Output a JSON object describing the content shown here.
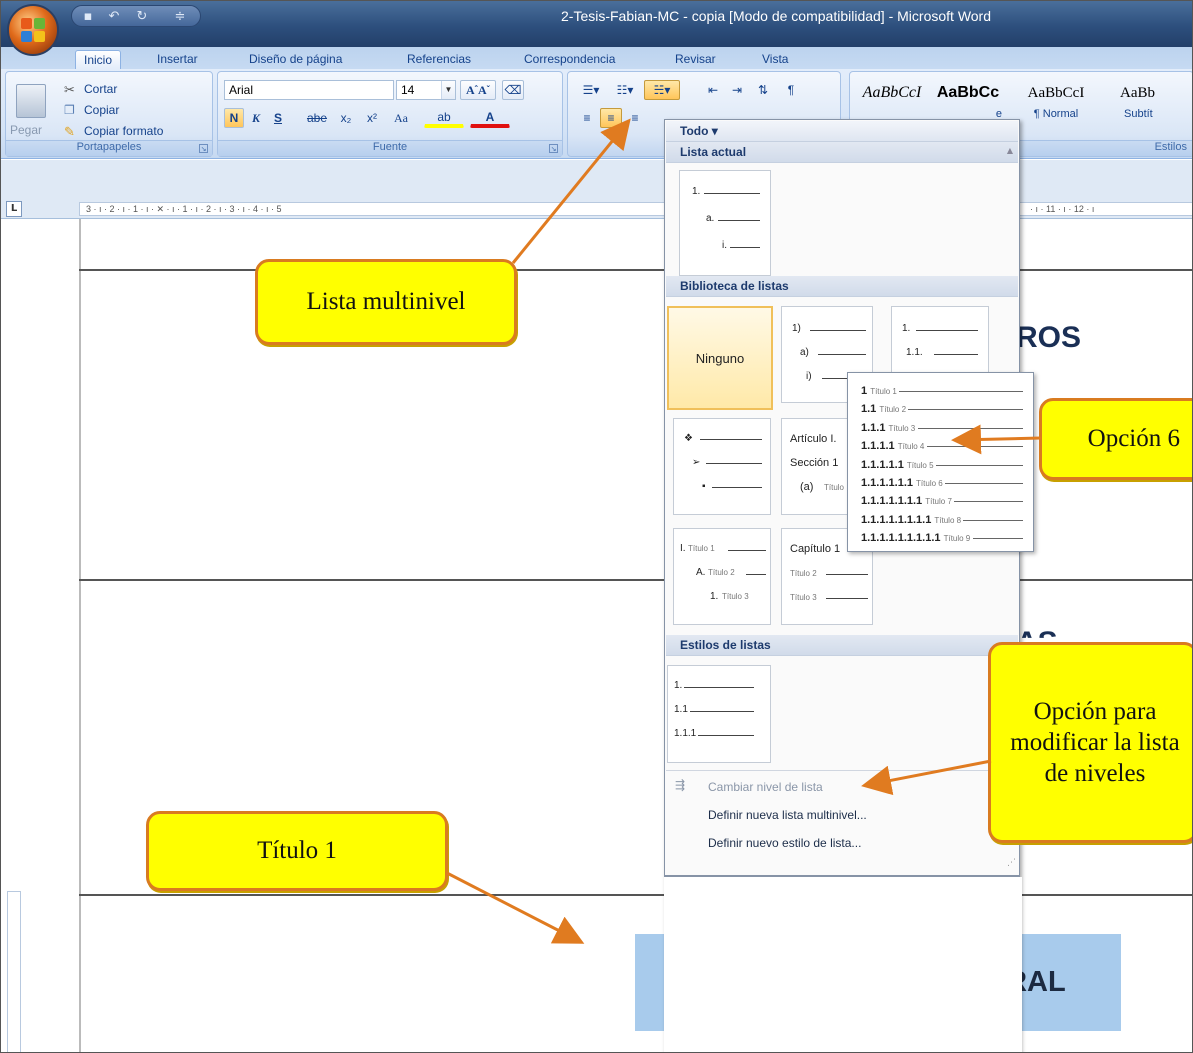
{
  "window": {
    "title": "2-Tesis-Fabian-MC - copia [Modo de compatibilidad] - Microsoft Word"
  },
  "tabs": [
    {
      "label": "Inicio"
    },
    {
      "label": "Insertar"
    },
    {
      "label": "Diseño de página"
    },
    {
      "label": "Referencias"
    },
    {
      "label": "Correspondencia"
    },
    {
      "label": "Revisar"
    },
    {
      "label": "Vista"
    }
  ],
  "ribbon": {
    "clipboard": {
      "paste": "Pegar",
      "cut": "Cortar",
      "copy": "Copiar",
      "format_painter": "Copiar formato",
      "group": "Portapapeles"
    },
    "font": {
      "name": "Arial",
      "size": "14",
      "group": "Fuente",
      "bold": "N",
      "italic": "K",
      "underline": "S",
      "strike": "abe",
      "sub": "x₂",
      "sup": "x²",
      "case": "Aa",
      "highlight": "ab",
      "color": "A"
    },
    "styles": {
      "group": "Estilos",
      "items": [
        {
          "sample": "AaBbCcI",
          "name": ""
        },
        {
          "sample": "AaBbCc",
          "name": "e"
        },
        {
          "sample": "AaBbCcI",
          "name": "¶ Normal"
        },
        {
          "sample": "AaBb",
          "name": "Subtít"
        }
      ]
    }
  },
  "ruler": {
    "text": "3 · ı · 2 · ı · 1 · ı · ✕ · ı · 1 · ı · 2 · ı · 3 · ı · 4 · ı · 5",
    "right": "· ı · 11 · ı · 12 · ı",
    "tab_selector": "L"
  },
  "document": {
    "heading1_fragment": "ROS",
    "heading2_fragment": "AS",
    "intro": "INTRODUCCIÓN GENERAL"
  },
  "menu": {
    "filter": "Todo ▾",
    "sections": {
      "current": "Lista actual",
      "library": "Biblioteca de listas",
      "styles": "Estilos de listas"
    },
    "current_list": [
      "1.",
      "a.",
      "i."
    ],
    "none_label": "Ninguno",
    "tile_a": [
      "1)",
      "a)",
      "i)"
    ],
    "tile_b": [
      "1.",
      "1.1."
    ],
    "tile_bullets": [
      "❖",
      "➢",
      "▪"
    ],
    "tile_article": [
      "Artículo I.",
      "Sección 1",
      "(a)",
      "Título"
    ],
    "tile_roman": [
      {
        "n": "I.",
        "t": "Título 1"
      },
      {
        "n": "A.",
        "t": "Título 2"
      },
      {
        "n": "1.",
        "t": "Título 3"
      }
    ],
    "tile_chapter": [
      {
        "n": "Capítulo 1",
        "t": ""
      },
      {
        "n": "",
        "t": "Título 2"
      },
      {
        "n": "",
        "t": "Título 3"
      }
    ],
    "style_list": [
      "1.",
      "1.1",
      "1.1.1"
    ],
    "actions": [
      {
        "label": "Cambiar nivel de lista",
        "disabled": true
      },
      {
        "label": "Definir nueva lista multinivel...",
        "disabled": false
      },
      {
        "label": "Definir nuevo estilo de lista...",
        "disabled": false
      }
    ]
  },
  "flyout": {
    "rows": [
      {
        "num": "1",
        "label": "Título 1"
      },
      {
        "num": "1.1",
        "label": "Título 2"
      },
      {
        "num": "1.1.1",
        "label": "Título 3"
      },
      {
        "num": "1.1.1.1",
        "label": "Título 4"
      },
      {
        "num": "1.1.1.1.1",
        "label": "Título 5"
      },
      {
        "num": "1.1.1.1.1.1",
        "label": "Título 6"
      },
      {
        "num": "1.1.1.1.1.1.1",
        "label": "Título 7"
      },
      {
        "num": "1.1.1.1.1.1.1.1",
        "label": "Título 8"
      },
      {
        "num": "1.1.1.1.1.1.1.1.1",
        "label": "Título 9"
      }
    ]
  },
  "callouts": {
    "multilevel": "Lista multinivel",
    "option6": "Opción 6",
    "modify": "Opción para modificar la lista de niveles",
    "title1": "Título 1"
  },
  "colors": {
    "callout_fill": "#ffff00",
    "callout_border": "#d97b20",
    "arrow": "#e07b20",
    "intro_bg": "#a8cbec"
  }
}
